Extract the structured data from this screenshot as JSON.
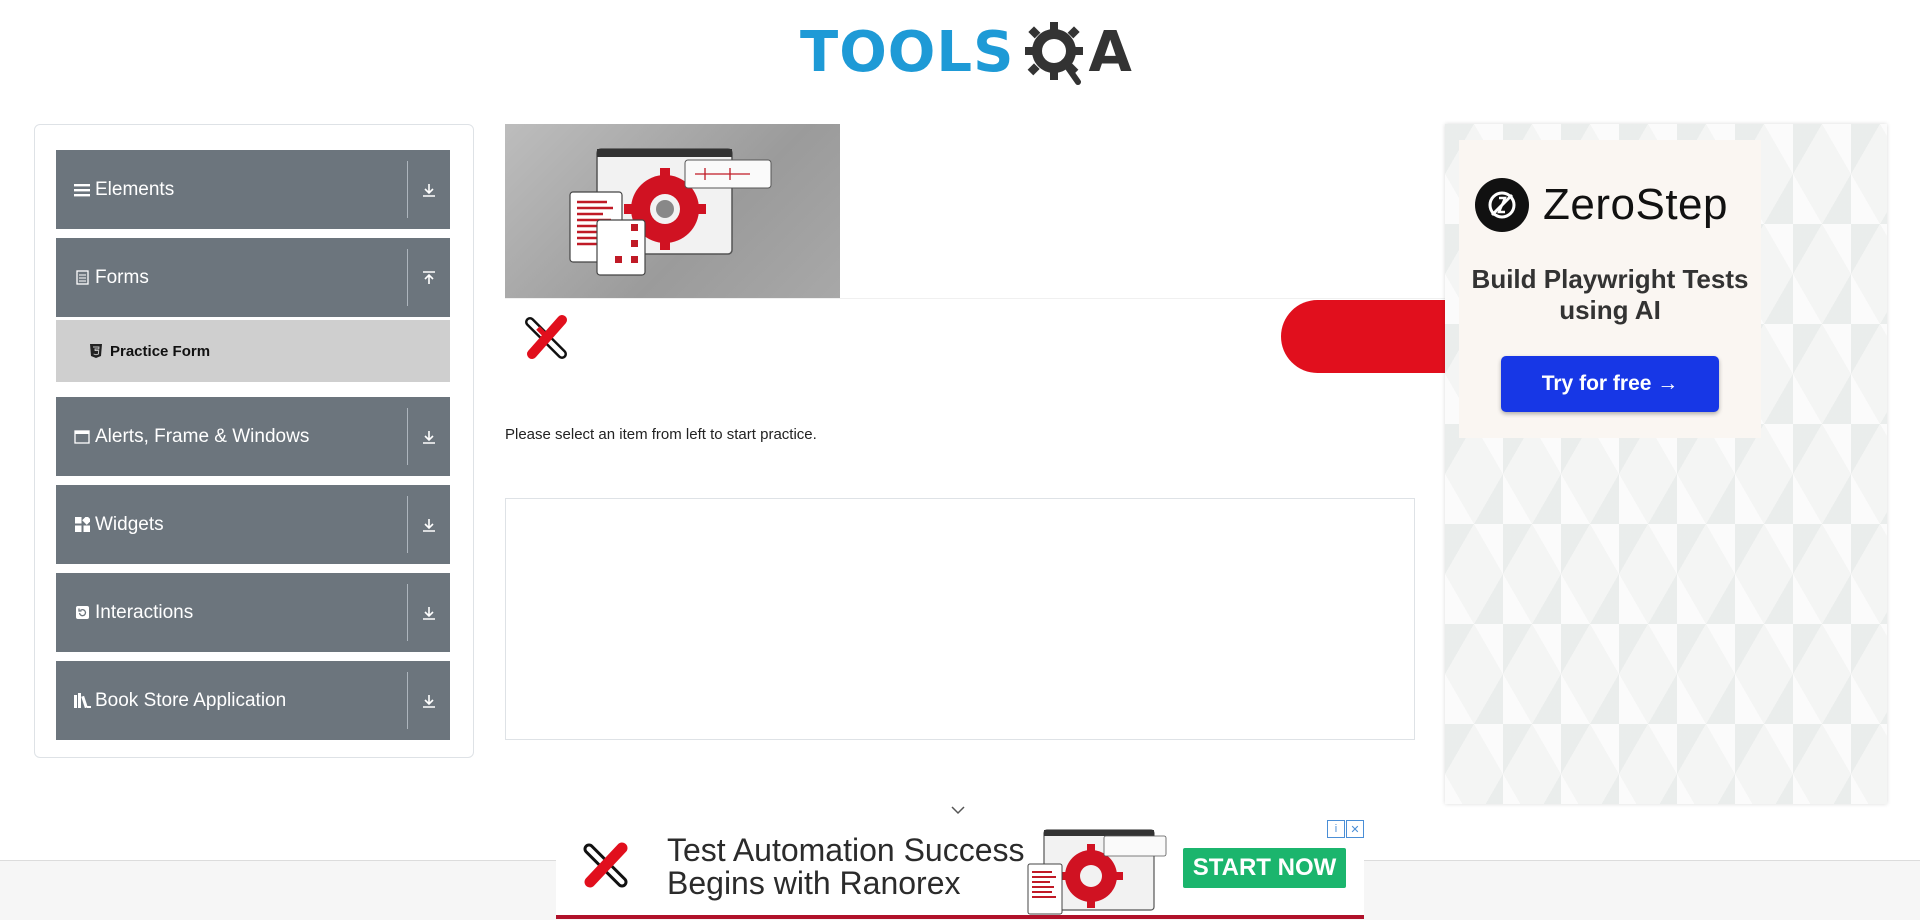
{
  "header": {
    "logo_part1": "TOOLS",
    "logo_part2": "A"
  },
  "sidebar": {
    "groups": [
      {
        "label": "Elements",
        "icon": "list-icon",
        "arrow": "download-arrow-icon"
      },
      {
        "label": "Forms",
        "icon": "document-icon",
        "arrow": "upload-arrow-icon"
      },
      {
        "label": "Alerts, Frame & Windows",
        "icon": "window-icon",
        "arrow": "download-arrow-icon"
      },
      {
        "label": "Widgets",
        "icon": "grid-icon",
        "arrow": "download-arrow-icon"
      },
      {
        "label": "Interactions",
        "icon": "refresh-icon",
        "arrow": "download-arrow-icon"
      },
      {
        "label": "Book Store Application",
        "icon": "books-icon",
        "arrow": "download-arrow-icon"
      }
    ],
    "active_submenu": {
      "label": "Practice Form",
      "icon": "html5-icon"
    }
  },
  "main": {
    "prompt": "Please select an item from left to start practice."
  },
  "right_ad": {
    "brand": "ZeroStep",
    "tagline": "Build Playwright Tests using AI",
    "cta": "Try for free →",
    "button_color": "#1737e6"
  },
  "bottom_ad": {
    "headline_line1": "Test Automation Success",
    "headline_line2": "Begins with Ranorex",
    "cta": "START NOW",
    "cta_color": "#1bb56d"
  },
  "colors": {
    "accent_blue": "#1e9ad6",
    "nav_gray": "#6c757d",
    "active_gray": "#cfcfcf",
    "ranorex_red": "#e10f1d"
  }
}
